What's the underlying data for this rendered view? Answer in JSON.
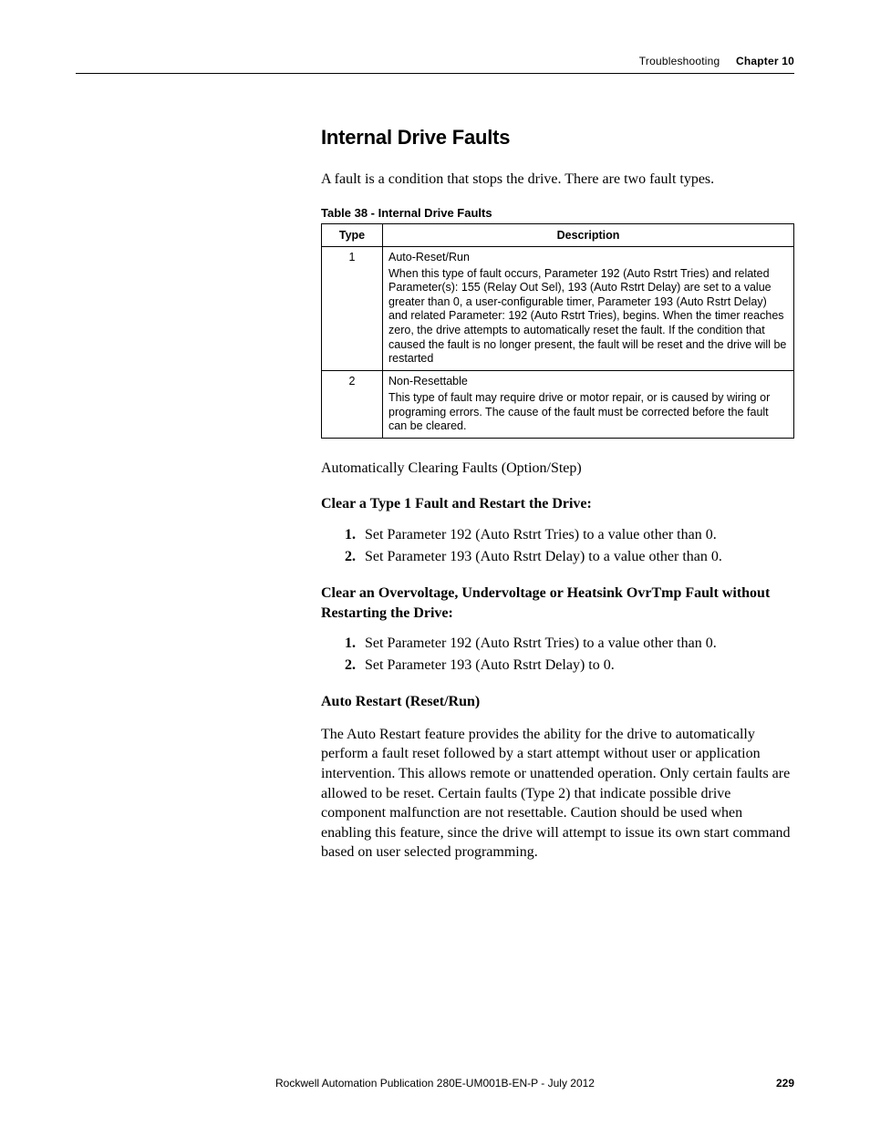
{
  "header": {
    "section": "Troubleshooting",
    "chapter": "Chapter 10"
  },
  "title": "Internal Drive Faults",
  "intro": "A fault is a condition that stops the drive. There are two fault types.",
  "table": {
    "caption": "Table 38 - Internal Drive Faults",
    "head": {
      "col1": "Type",
      "col2": "Description"
    },
    "rows": [
      {
        "type": "1",
        "title": "Auto-Reset/Run",
        "body": "When this type of fault occurs, Parameter 192 (Auto Rstrt Tries) and related Parameter(s): 155 (Relay Out Sel), 193 (Auto Rstrt Delay) are set to a value greater than 0, a user-configurable timer, Parameter 193 (Auto Rstrt Delay) and related Parameter: 192 (Auto Rstrt Tries), begins. When the timer reaches zero, the drive attempts to automatically reset the fault. If the condition that caused the fault is no longer present, the fault will be reset and the drive will be restarted"
      },
      {
        "type": "2",
        "title": "Non-Resettable",
        "body": "This type of fault may require drive or motor repair, or is caused by wiring or programing errors. The cause of the fault must be corrected before the fault can be cleared."
      }
    ]
  },
  "auto_clear_line": "Automatically Clearing Faults (Option/Step)",
  "subhead1": "Clear a Type 1 Fault and Restart the Drive:",
  "steps1": [
    "Set Parameter 192 (Auto Rstrt Tries) to a value other than 0.",
    "Set Parameter 193 (Auto Rstrt Delay) to a value other than 0."
  ],
  "subhead2": "Clear an Overvoltage, Undervoltage or Heatsink OvrTmp Fault without Restarting the Drive:",
  "steps2": [
    "Set Parameter 192 (Auto Rstrt Tries) to a value other than 0.",
    "Set Parameter 193 (Auto Rstrt Delay) to 0."
  ],
  "subhead3": "Auto Restart (Reset/Run)",
  "paragraph3": "The Auto Restart feature provides the ability for the drive to automatically perform a fault reset followed by a start attempt without user or application intervention. This allows remote or unattended operation. Only certain faults are allowed to be reset. Certain faults (Type 2) that indicate possible drive component malfunction are not resettable. Caution should be used when enabling this feature, since the drive will attempt to issue its own start command based on user selected programming.",
  "footer": {
    "publication": "Rockwell Automation Publication 280E-UM001B-EN-P - July 2012",
    "page": "229"
  }
}
